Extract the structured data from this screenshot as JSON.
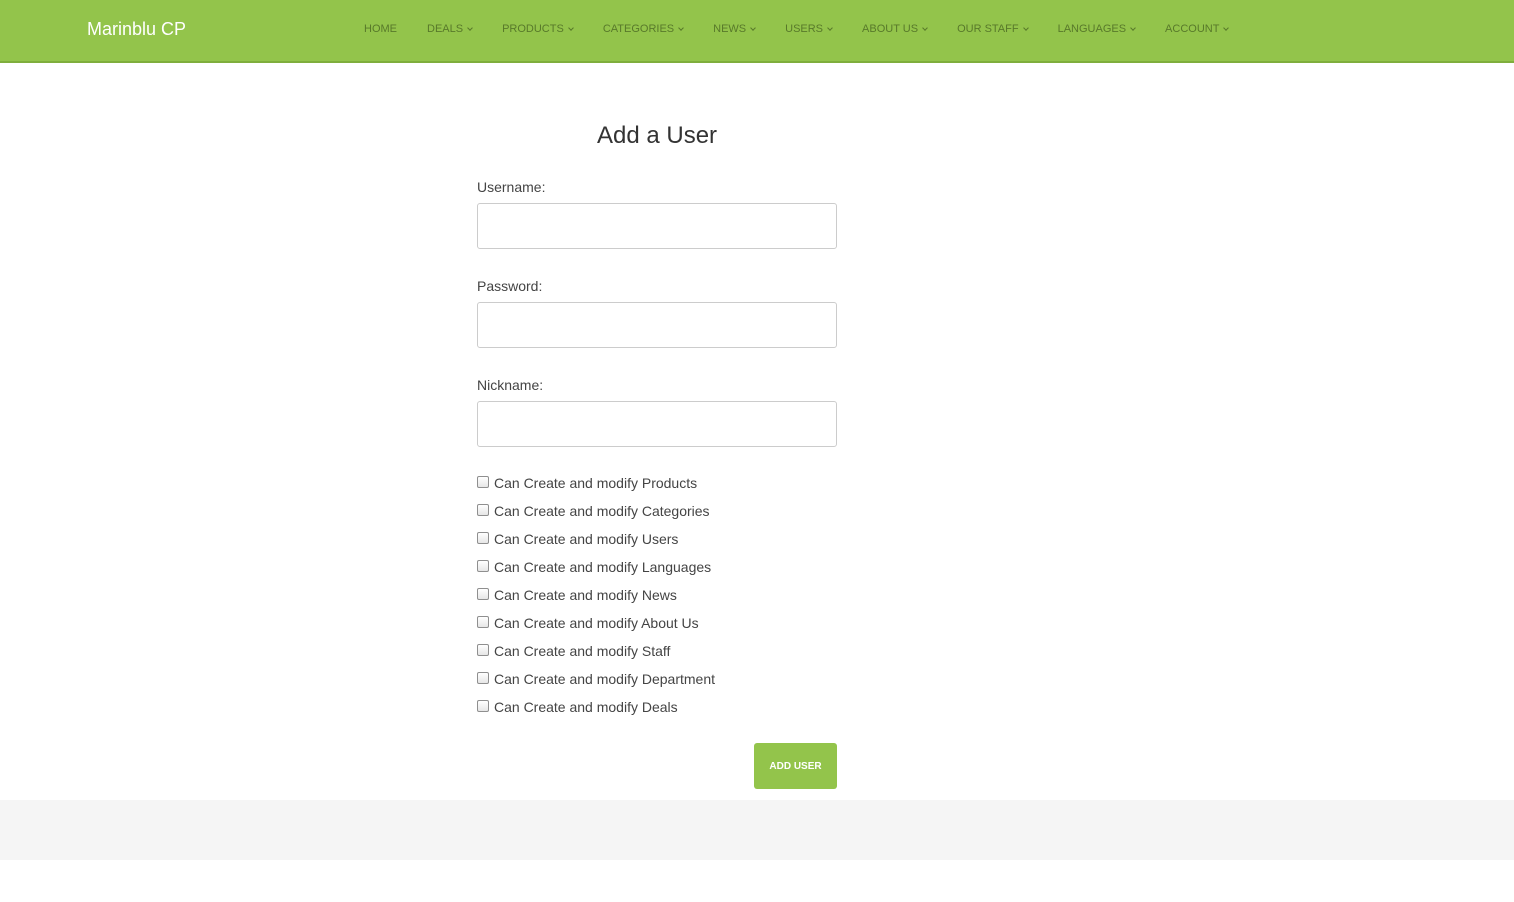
{
  "brand": "Marinblu CP",
  "nav": {
    "items": [
      {
        "label": "HOME",
        "dropdown": false
      },
      {
        "label": "DEALS",
        "dropdown": true
      },
      {
        "label": "PRODUCTS",
        "dropdown": true
      },
      {
        "label": "CATEGORIES",
        "dropdown": true
      },
      {
        "label": "NEWS",
        "dropdown": true
      },
      {
        "label": "USERS",
        "dropdown": true
      },
      {
        "label": "ABOUT US",
        "dropdown": true
      },
      {
        "label": "OUR STAFF",
        "dropdown": true
      },
      {
        "label": "LANGUAGES",
        "dropdown": true
      },
      {
        "label": "ACCOUNT",
        "dropdown": true
      }
    ]
  },
  "form": {
    "title": "Add a User",
    "username_label": "Username:",
    "username_value": "",
    "password_label": "Password:",
    "password_value": "",
    "nickname_label": "Nickname:",
    "nickname_value": "",
    "permissions": [
      {
        "label": "Can Create and modify Products",
        "checked": false
      },
      {
        "label": "Can Create and modify Categories",
        "checked": false
      },
      {
        "label": "Can Create and modify Users",
        "checked": false
      },
      {
        "label": "Can Create and modify Languages",
        "checked": false
      },
      {
        "label": "Can Create and modify News",
        "checked": false
      },
      {
        "label": "Can Create and modify About Us",
        "checked": false
      },
      {
        "label": "Can Create and modify Staff",
        "checked": false
      },
      {
        "label": "Can Create and modify Department",
        "checked": false
      },
      {
        "label": "Can Create and modify Deals",
        "checked": false
      }
    ],
    "submit_label": "ADD USER"
  },
  "colors": {
    "accent": "#93c44b",
    "nav_text": "#4e6d25",
    "footer_bg": "#f5f5f5"
  }
}
